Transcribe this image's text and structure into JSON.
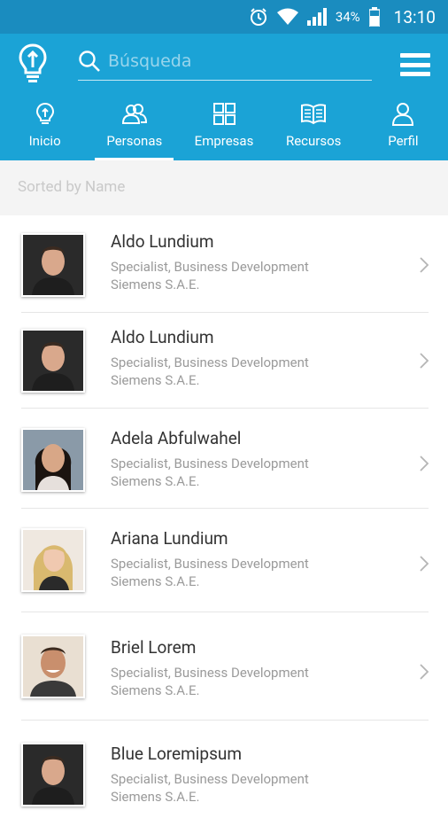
{
  "status_bar": {
    "battery": "34%",
    "time": "13:10",
    "icons": [
      "alarm-icon",
      "wifi-icon",
      "signal-icon",
      "battery-icon"
    ]
  },
  "app_bar": {
    "search_placeholder": "Búsqueda",
    "icons": [
      "lightbulb-logo-icon",
      "search-icon",
      "menu-icon"
    ]
  },
  "tabs": [
    {
      "label": "Inicio",
      "icon": "lightbulb-icon",
      "active": false
    },
    {
      "label": "Personas",
      "icon": "people-icon",
      "active": true
    },
    {
      "label": "Empresas",
      "icon": "grid-icon",
      "active": false
    },
    {
      "label": "Recursos",
      "icon": "book-icon",
      "active": false
    },
    {
      "label": "Perfil",
      "icon": "person-icon",
      "active": false
    }
  ],
  "sort_label": "Sorted by Name",
  "people": [
    {
      "name": "Aldo Lundium",
      "title": "Specialist, Business Development",
      "company": "Siemens S.A.E."
    },
    {
      "name": "Aldo Lundium",
      "title": "Specialist, Business Development",
      "company": "Siemens S.A.E."
    },
    {
      "name": "Adela Abfulwahel",
      "title": "Specialist, Business Development",
      "company": "Siemens S.A.E."
    },
    {
      "name": "Ariana Lundium",
      "title": "Specialist, Business Development",
      "company": "Siemens S.A.E."
    },
    {
      "name": "Briel Lorem",
      "title": "Specialist, Business Development",
      "company": "Siemens S.A.E."
    },
    {
      "name": "Blue Loremipsum",
      "title": "Specialist, Business Development",
      "company": "Siemens S.A.E."
    }
  ],
  "colors": {
    "status_bar": "#1a8cbf",
    "primary": "#1ba3d6",
    "sort_bar": "#f4f4f4"
  }
}
